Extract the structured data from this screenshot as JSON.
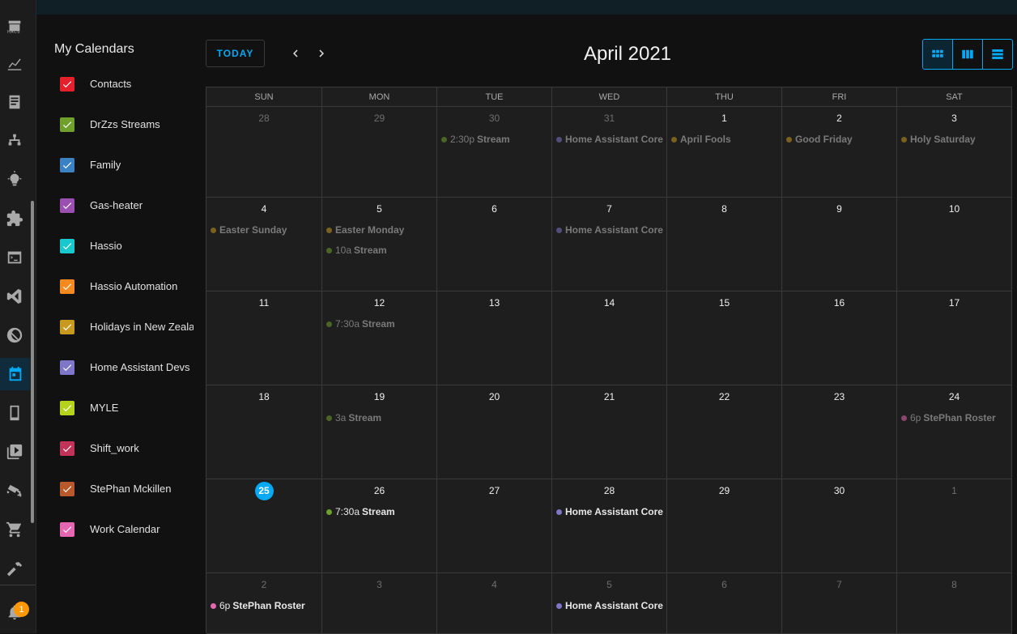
{
  "rail": {
    "hacs_label": "HACS",
    "items": [
      "hacs-icon",
      "energy-chart-icon",
      "logbook-icon",
      "network-icon",
      "lightbulb-icon",
      "puzzle-icon",
      "terminal-icon",
      "vscode-icon",
      "zwave-icon",
      "calendar-icon",
      "tablet-icon",
      "media-icon",
      "cctv-icon",
      "cart-icon",
      "hammer-icon",
      "bell-icon"
    ],
    "active": "calendar-icon",
    "notification_count": "1"
  },
  "sidebar": {
    "title": "My Calendars",
    "calendars": [
      {
        "label": "Contacts",
        "color": "#e4202c"
      },
      {
        "label": "DrZzs Streams",
        "color": "#6fa02c"
      },
      {
        "label": "Family",
        "color": "#3b82c4"
      },
      {
        "label": "Gas-heater",
        "color": "#9b4fb0"
      },
      {
        "label": "Hassio",
        "color": "#18c8cc"
      },
      {
        "label": "Hassio Automation",
        "color": "#f68a1e"
      },
      {
        "label": "Holidays in New Zealand",
        "color": "#c79a1e"
      },
      {
        "label": "Home Assistant Devs",
        "color": "#7e77c9"
      },
      {
        "label": "MYLE",
        "color": "#b5d21d"
      },
      {
        "label": "Shift_work",
        "color": "#c2335a"
      },
      {
        "label": "StePhan Mckillen",
        "color": "#b8582b"
      },
      {
        "label": "Work Calendar",
        "color": "#e667b1"
      }
    ]
  },
  "header": {
    "today_label": "TODAY",
    "month_title": "April 2021",
    "views": [
      "month-view-icon",
      "week-view-icon",
      "list-view-icon"
    ],
    "selected_view": "month-view-icon"
  },
  "colors": {
    "accent": "#03a9f4",
    "stream": "#6fa02c",
    "holiday": "#c79a1e",
    "devs": "#7e77c9",
    "roster": "#e667b1"
  },
  "calendar": {
    "weekdays": [
      "SUN",
      "MON",
      "TUE",
      "WED",
      "THU",
      "FRI",
      "SAT"
    ],
    "weeks": [
      [
        {
          "day": "28",
          "other": true,
          "events": []
        },
        {
          "day": "29",
          "other": true,
          "events": []
        },
        {
          "day": "30",
          "other": true,
          "events": [
            {
              "time": "2:30p",
              "title": "Stream",
              "color": "#6fa02c",
              "dim": true
            }
          ]
        },
        {
          "day": "31",
          "other": true,
          "events": [
            {
              "time": "",
              "title": "Home Assistant Core Beta",
              "color": "#7e77c9",
              "dim": true
            }
          ]
        },
        {
          "day": "1",
          "events": [
            {
              "time": "",
              "title": "April Fools",
              "color": "#c79a1e",
              "dim": true
            }
          ]
        },
        {
          "day": "2",
          "events": [
            {
              "time": "",
              "title": "Good Friday",
              "color": "#c79a1e",
              "dim": true
            }
          ]
        },
        {
          "day": "3",
          "events": [
            {
              "time": "",
              "title": "Holy Saturday",
              "color": "#c79a1e",
              "dim": true
            }
          ]
        }
      ],
      [
        {
          "day": "4",
          "events": [
            {
              "time": "",
              "title": "Easter Sunday",
              "color": "#c79a1e",
              "dim": true
            }
          ]
        },
        {
          "day": "5",
          "events": [
            {
              "time": "",
              "title": "Easter Monday",
              "color": "#c79a1e",
              "dim": true
            },
            {
              "time": "10a",
              "title": "Stream",
              "color": "#6fa02c",
              "dim": true
            }
          ]
        },
        {
          "day": "6",
          "events": []
        },
        {
          "day": "7",
          "events": [
            {
              "time": "",
              "title": "Home Assistant Core Release",
              "color": "#7e77c9",
              "dim": true
            }
          ]
        },
        {
          "day": "8",
          "events": []
        },
        {
          "day": "9",
          "events": []
        },
        {
          "day": "10",
          "events": []
        }
      ],
      [
        {
          "day": "11",
          "events": []
        },
        {
          "day": "12",
          "events": [
            {
              "time": "7:30a",
              "title": "Stream",
              "color": "#6fa02c",
              "dim": true
            }
          ]
        },
        {
          "day": "13",
          "events": []
        },
        {
          "day": "14",
          "events": []
        },
        {
          "day": "15",
          "events": []
        },
        {
          "day": "16",
          "events": []
        },
        {
          "day": "17",
          "events": []
        }
      ],
      [
        {
          "day": "18",
          "events": []
        },
        {
          "day": "19",
          "events": [
            {
              "time": "3a",
              "title": "Stream",
              "color": "#6fa02c",
              "dim": true
            }
          ]
        },
        {
          "day": "20",
          "events": []
        },
        {
          "day": "21",
          "events": []
        },
        {
          "day": "22",
          "events": []
        },
        {
          "day": "23",
          "events": []
        },
        {
          "day": "24",
          "events": [
            {
              "time": "6p",
              "title": "StePhan Roster",
              "color": "#e667b1",
              "dim": true
            }
          ]
        }
      ],
      [
        {
          "day": "25",
          "today": true,
          "events": []
        },
        {
          "day": "26",
          "events": [
            {
              "time": "7:30a",
              "title": "Stream",
              "color": "#6fa02c",
              "dim": false
            }
          ]
        },
        {
          "day": "27",
          "events": []
        },
        {
          "day": "28",
          "events": [
            {
              "time": "",
              "title": "Home Assistant Core Beta",
              "color": "#7e77c9",
              "dim": false
            }
          ]
        },
        {
          "day": "29",
          "events": []
        },
        {
          "day": "30",
          "events": []
        },
        {
          "day": "1",
          "other": true,
          "events": []
        }
      ],
      [
        {
          "day": "2",
          "other": true,
          "events": [
            {
              "time": "6p",
              "title": "StePhan Roster",
              "color": "#e667b1",
              "dim": false
            }
          ]
        },
        {
          "day": "3",
          "other": true,
          "events": []
        },
        {
          "day": "4",
          "other": true,
          "events": []
        },
        {
          "day": "5",
          "other": true,
          "events": [
            {
              "time": "",
              "title": "Home Assistant Core Release",
              "color": "#7e77c9",
              "dim": false
            }
          ]
        },
        {
          "day": "6",
          "other": true,
          "events": []
        },
        {
          "day": "7",
          "other": true,
          "events": []
        },
        {
          "day": "8",
          "other": true,
          "events": []
        }
      ]
    ]
  }
}
